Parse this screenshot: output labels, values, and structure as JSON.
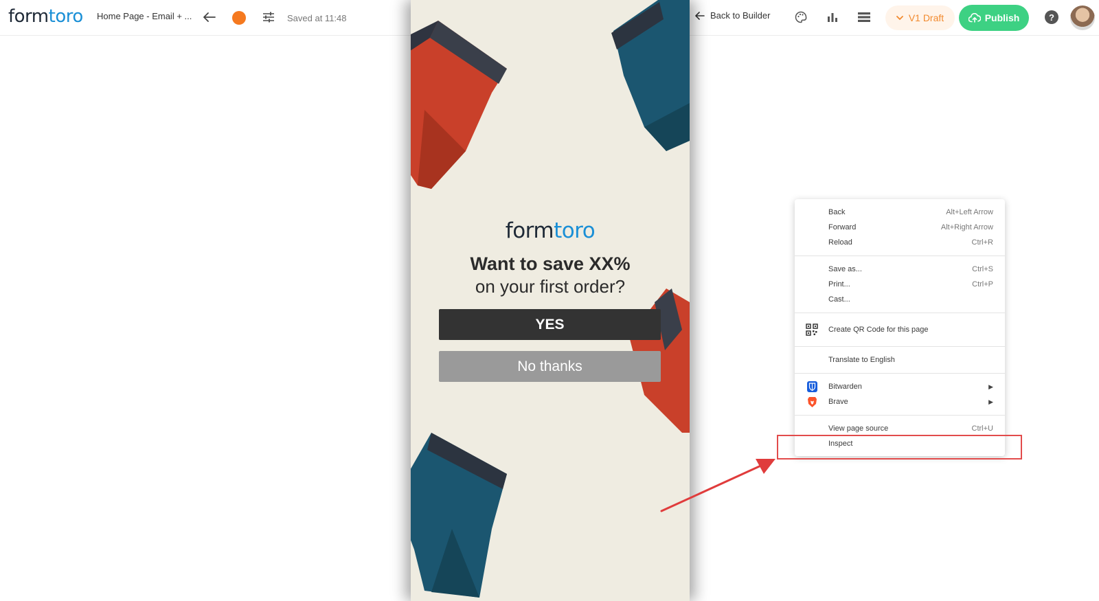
{
  "topbar": {
    "logo_part1": "form",
    "logo_part2": "toro",
    "page_name": "Home Page - Email + ...",
    "saved_text": "Saved at 11:48",
    "back_to_builder": "Back to Builder",
    "draft_label": "V1 Draft",
    "publish_label": "Publish",
    "help_label": "?"
  },
  "popup": {
    "brand_part1": "form",
    "brand_part2": "toro",
    "headline": "Want to save XX%",
    "subline": "on your first order?",
    "yes_label": "YES",
    "no_label": "No thanks"
  },
  "context_menu": {
    "group1": [
      {
        "label": "Back",
        "shortcut": "Alt+Left Arrow"
      },
      {
        "label": "Forward",
        "shortcut": "Alt+Right Arrow"
      },
      {
        "label": "Reload",
        "shortcut": "Ctrl+R"
      }
    ],
    "group2": [
      {
        "label": "Save as...",
        "shortcut": "Ctrl+S"
      },
      {
        "label": "Print...",
        "shortcut": "Ctrl+P"
      },
      {
        "label": "Cast..."
      }
    ],
    "qr_label": "Create QR Code for this page",
    "translate_label": "Translate to English",
    "bitwarden_label": "Bitwarden",
    "brave_label": "Brave",
    "view_source_label": "View page source",
    "view_source_shortcut": "Ctrl+U",
    "inspect_label": "Inspect"
  },
  "colors": {
    "accent_orange": "#f5791f",
    "publish_green": "#3dd183",
    "brand_blue": "#1a8fd6",
    "highlight_red": "#e24b4b"
  },
  "icons": {
    "back": "arrow-left-icon",
    "status": "orange-dot-icon",
    "settings": "sliders-icon",
    "palette": "palette-icon",
    "analytics": "bar-chart-icon",
    "list": "list-icon",
    "draft": "chevron-down-icon",
    "publish": "cloud-upload-icon",
    "help": "help-icon"
  }
}
